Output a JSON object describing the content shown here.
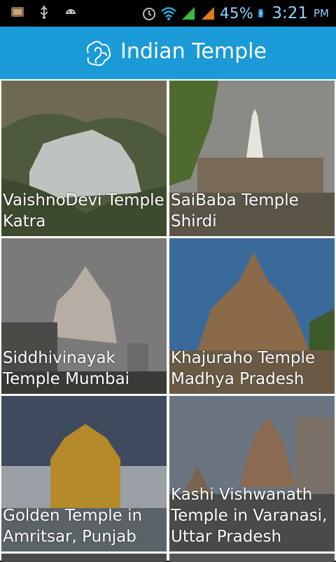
{
  "status_bar": {
    "battery_percent": "45%",
    "time": "3:21",
    "ampm": "PM",
    "icons": [
      "app-icon",
      "usb-icon",
      "android-icon",
      "alarm-icon",
      "wifi-icon",
      "signal-icon",
      "signal-icon-2",
      "battery-icon"
    ]
  },
  "app_bar": {
    "title": "Indian Temple",
    "logo_icon": "ganesha-logo-icon",
    "color": "#1a9ad6"
  },
  "temples": [
    {
      "name": "VaishnoDevi Temple Katra"
    },
    {
      "name": "SaiBaba Temple Shirdi"
    },
    {
      "name": "Siddhivinayak Temple  Mumbai"
    },
    {
      "name": "Khajuraho Temple Madhya Pradesh"
    },
    {
      "name": "Golden Temple in Amritsar, Punjab"
    },
    {
      "name": "Kashi Vishwanath Temple in Varanasi, Uttar Pradesh"
    }
  ]
}
